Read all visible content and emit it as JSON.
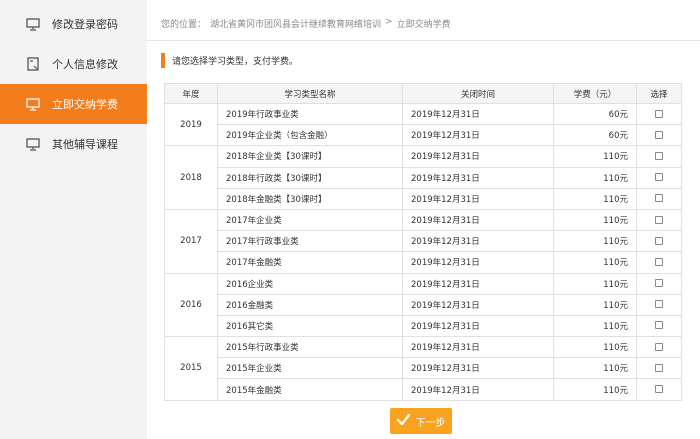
{
  "sidebar": {
    "items": [
      {
        "label": "修改登录密码",
        "icon": "monitor-icon"
      },
      {
        "label": "个人信息修改",
        "icon": "document-icon"
      },
      {
        "label": "立即交纳学费",
        "icon": "monitor-icon",
        "active": true
      },
      {
        "label": "其他辅导课程",
        "icon": "monitor-icon"
      }
    ]
  },
  "breadcrumb": {
    "prefix": "您的位置：",
    "site": "湖北省黄冈市团风县会计继续教育网络培训",
    "separator": ">",
    "current": "立即交纳学费"
  },
  "notice": "请您选择学习类型，支付学费。",
  "table": {
    "headers": [
      "年度",
      "学习类型名称",
      "关闭时间",
      "学费（元）",
      "选择"
    ],
    "groups": [
      {
        "year": "2019",
        "rows": [
          {
            "name": "2019年行政事业类",
            "close": "2019年12月31日",
            "fee": "60元"
          },
          {
            "name": "2019年企业类（包含金融）",
            "close": "2019年12月31日",
            "fee": "60元"
          }
        ]
      },
      {
        "year": "2018",
        "rows": [
          {
            "name": "2018年企业类【30课时】",
            "close": "2019年12月31日",
            "fee": "110元"
          },
          {
            "name": "2018年行政类【30课时】",
            "close": "2019年12月31日",
            "fee": "110元"
          },
          {
            "name": "2018年金融类【30课时】",
            "close": "2019年12月31日",
            "fee": "110元"
          }
        ]
      },
      {
        "year": "2017",
        "rows": [
          {
            "name": "2017年企业类",
            "close": "2019年12月31日",
            "fee": "110元"
          },
          {
            "name": "2017年行政事业类",
            "close": "2019年12月31日",
            "fee": "110元"
          },
          {
            "name": "2017年金融类",
            "close": "2019年12月31日",
            "fee": "110元"
          }
        ]
      },
      {
        "year": "2016",
        "rows": [
          {
            "name": "2016企业类",
            "close": "2019年12月31日",
            "fee": "110元"
          },
          {
            "name": "2016金融类",
            "close": "2019年12月31日",
            "fee": "110元"
          },
          {
            "name": "2016其它类",
            "close": "2019年12月31日",
            "fee": "110元"
          }
        ]
      },
      {
        "year": "2015",
        "rows": [
          {
            "name": "2015年行政事业类",
            "close": "2019年12月31日",
            "fee": "110元"
          },
          {
            "name": "2015年企业类",
            "close": "2019年12月31日",
            "fee": "110元"
          },
          {
            "name": "2015年金融类",
            "close": "2019年12月31日",
            "fee": "110元"
          }
        ]
      }
    ]
  },
  "next_button": {
    "label": "下一步",
    "icon": "checkmark-icon"
  },
  "colors": {
    "accent": "#f37c1d",
    "button": "#f8a21f"
  }
}
